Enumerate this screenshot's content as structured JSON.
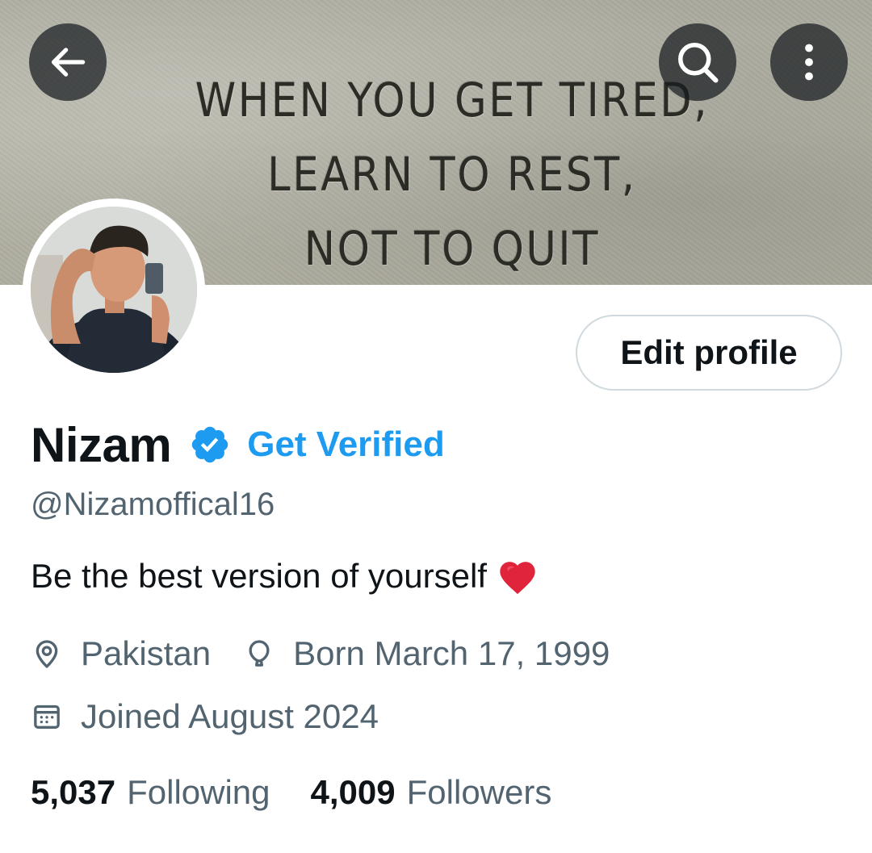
{
  "banner": {
    "quote_lines": [
      "WHEN YOU GET TIRED,",
      "LEARN TO REST,",
      "NOT TO QUIT"
    ]
  },
  "header": {
    "back_icon": "arrow-left-icon",
    "search_icon": "search-icon",
    "more_icon": "more-vertical-icon"
  },
  "profile": {
    "edit_label": "Edit profile",
    "name": "Nizam",
    "verified_icon": "verified-badge-icon",
    "get_verified_label": "Get Verified",
    "handle": "@Nizamoffical16",
    "bio": "Be the best version of yourself",
    "bio_emoji": "red-heart",
    "location": "Pakistan",
    "birthday": "Born March 17, 1999",
    "joined": "Joined August 2024",
    "following_count": "5,037",
    "following_label": "Following",
    "followers_count": "4,009",
    "followers_label": "Followers"
  },
  "colors": {
    "accent": "#1d9bf0",
    "text_primary": "#0f1419",
    "text_secondary": "#536471",
    "border": "#cfd9de"
  }
}
